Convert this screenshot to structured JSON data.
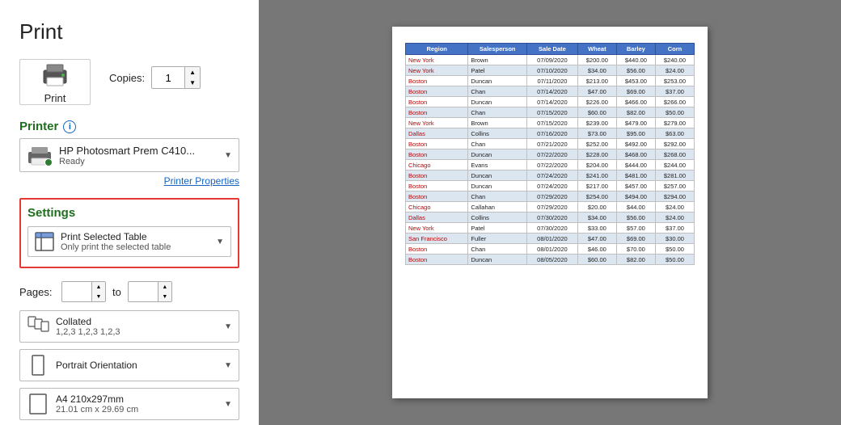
{
  "title": "Print",
  "copies": {
    "label": "Copies:",
    "value": "1"
  },
  "print_button": {
    "label": "Print"
  },
  "printer": {
    "section_title": "Printer",
    "name": "HP Photosmart Prem C410...",
    "status": "Ready",
    "properties_link": "Printer Properties"
  },
  "settings": {
    "section_title": "Settings",
    "print_scope": {
      "main": "Print Selected Table",
      "sub": "Only print the selected table"
    },
    "pages": {
      "label": "Pages:",
      "from": "",
      "to_label": "to",
      "to": ""
    },
    "collation": {
      "main": "Collated",
      "sub": "1,2,3  1,2,3  1,2,3"
    },
    "orientation": {
      "main": "Portrait Orientation",
      "sub": ""
    },
    "paper": {
      "main": "A4 210x297mm",
      "sub": "21.01 cm x 29.69 cm"
    }
  },
  "table": {
    "headers": [
      "Region",
      "Salesperson",
      "Sale Date",
      "Wheat",
      "Barley",
      "Corn"
    ],
    "rows": [
      [
        "New York",
        "Brown",
        "07/09/2020",
        "$200.00",
        "$440.00",
        "$240.00"
      ],
      [
        "New York",
        "Patel",
        "07/10/2020",
        "$34.00",
        "$56.00",
        "$24.00"
      ],
      [
        "Boston",
        "Duncan",
        "07/11/2020",
        "$213.00",
        "$453.00",
        "$253.00"
      ],
      [
        "Boston",
        "Chan",
        "07/14/2020",
        "$47.00",
        "$69.00",
        "$37.00"
      ],
      [
        "Boston",
        "Duncan",
        "07/14/2020",
        "$226.00",
        "$466.00",
        "$266.00"
      ],
      [
        "Boston",
        "Chan",
        "07/15/2020",
        "$60.00",
        "$82.00",
        "$50.00"
      ],
      [
        "New York",
        "Brown",
        "07/15/2020",
        "$239.00",
        "$479.00",
        "$279.00"
      ],
      [
        "Dallas",
        "Collins",
        "07/16/2020",
        "$73.00",
        "$95.00",
        "$63.00"
      ],
      [
        "Boston",
        "Chan",
        "07/21/2020",
        "$252.00",
        "$492.00",
        "$292.00"
      ],
      [
        "Boston",
        "Duncan",
        "07/22/2020",
        "$228.00",
        "$468.00",
        "$268.00"
      ],
      [
        "Chicago",
        "Evans",
        "07/22/2020",
        "$204.00",
        "$444.00",
        "$244.00"
      ],
      [
        "Boston",
        "Duncan",
        "07/24/2020",
        "$241.00",
        "$481.00",
        "$281.00"
      ],
      [
        "Boston",
        "Duncan",
        "07/24/2020",
        "$217.00",
        "$457.00",
        "$257.00"
      ],
      [
        "Boston",
        "Chan",
        "07/29/2020",
        "$254.00",
        "$494.00",
        "$294.00"
      ],
      [
        "Chicago",
        "Callahan",
        "07/29/2020",
        "$20.00",
        "$44.00",
        "$24.00"
      ],
      [
        "Dallas",
        "Collins",
        "07/30/2020",
        "$34.00",
        "$56.00",
        "$24.00"
      ],
      [
        "New York",
        "Patel",
        "07/30/2020",
        "$33.00",
        "$57.00",
        "$37.00"
      ],
      [
        "San Francisco",
        "Fuller",
        "08/01/2020",
        "$47.00",
        "$69.00",
        "$30.00"
      ],
      [
        "Boston",
        "Chan",
        "08/01/2020",
        "$46.00",
        "$70.00",
        "$50.00"
      ],
      [
        "Boston",
        "Duncan",
        "08/05/2020",
        "$60.00",
        "$82.00",
        "$50.00"
      ]
    ]
  }
}
